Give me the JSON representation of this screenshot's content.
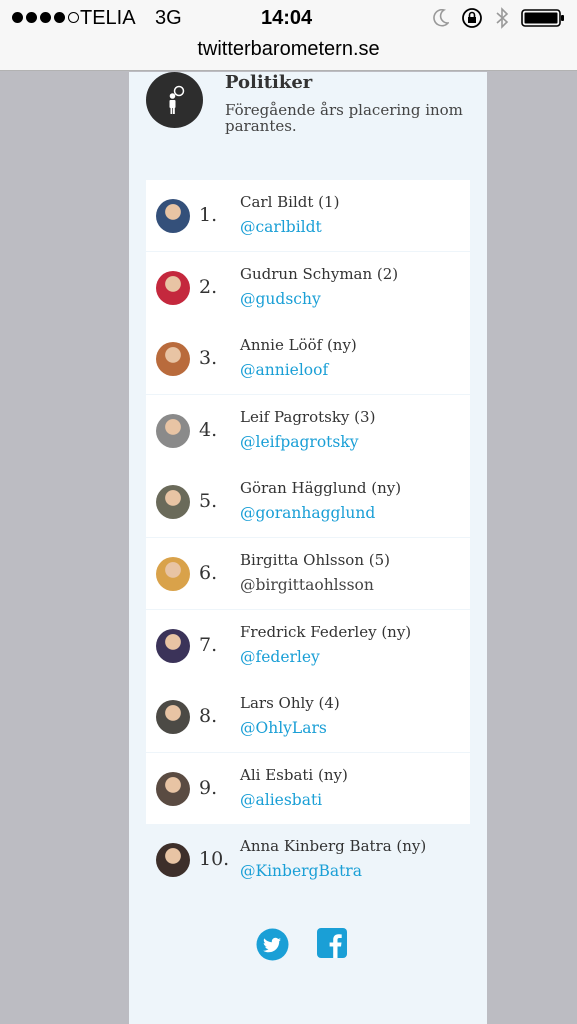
{
  "status_bar": {
    "carrier": "TELIA",
    "network": "3G",
    "time": "14:04",
    "icons": [
      "moon-icon",
      "rotation-lock-icon",
      "bluetooth-icon",
      "battery-icon"
    ]
  },
  "browser": {
    "url": "twitterbarometern.se"
  },
  "header": {
    "title": "Politiker",
    "subtitle": "Föregående års placering inom parantes."
  },
  "colors": {
    "link": "#1a9fd6",
    "panel": "#eef5fa",
    "icon_circle": "#2d2d2d"
  },
  "ranking": [
    {
      "rank": "1.",
      "name": "Carl Bildt (1)",
      "handle": "@carlbildt",
      "linked": true,
      "avatar_color": "#34507a"
    },
    {
      "rank": "2.",
      "name": "Gudrun Schyman (2)",
      "handle": "@gudschy",
      "linked": true,
      "avatar_color": "#c4283d"
    },
    {
      "rank": "3.",
      "name": "Annie Lööf (ny)",
      "handle": "@annieloof",
      "linked": true,
      "avatar_color": "#b96b3c"
    },
    {
      "rank": "4.",
      "name": "Leif Pagrotsky (3)",
      "handle": "@leifpagrotsky",
      "linked": true,
      "avatar_color": "#8a8a8a"
    },
    {
      "rank": "5.",
      "name": "Göran Hägglund (ny)",
      "handle": "@goranhagglund",
      "linked": true,
      "avatar_color": "#6a6a5a"
    },
    {
      "rank": "6.",
      "name": "Birgitta Ohlsson (5)",
      "handle": "@birgittaohlsson",
      "linked": false,
      "avatar_color": "#d9a24a"
    },
    {
      "rank": "7.",
      "name": "Fredrick Federley (ny)",
      "handle": "@federley",
      "linked": true,
      "avatar_color": "#3b3359"
    },
    {
      "rank": "8.",
      "name": "Lars Ohly (4)",
      "handle": "@OhlyLars",
      "linked": true,
      "avatar_color": "#4c4a45"
    },
    {
      "rank": "9.",
      "name": "Ali Esbati (ny)",
      "handle": "@aliesbati",
      "linked": true,
      "avatar_color": "#5a4b42"
    },
    {
      "rank": "10.",
      "name": "Anna Kinberg Batra (ny)",
      "handle": "@KinbergBatra",
      "linked": true,
      "avatar_color": "#3d2f2a"
    }
  ],
  "social": [
    "twitter-icon",
    "facebook-icon"
  ]
}
